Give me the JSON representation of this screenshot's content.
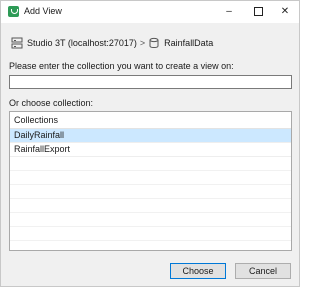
{
  "window": {
    "title": "Add View"
  },
  "breadcrumb": {
    "connection": "Studio 3T (localhost:27017)",
    "separator": ">",
    "database": "RainfallData"
  },
  "prompt": "Please enter the collection you want to create a view on:",
  "input": {
    "value": ""
  },
  "choose_label": "Or choose collection:",
  "collections": {
    "header": "Collections",
    "items": [
      "DailyRainfall",
      "RainfallExport"
    ],
    "selected_index": 0
  },
  "buttons": {
    "choose": "Choose",
    "cancel": "Cancel"
  },
  "colors": {
    "selection": "#cce8ff",
    "app_icon": "#2e9b57",
    "accent_border": "#0078d7"
  }
}
